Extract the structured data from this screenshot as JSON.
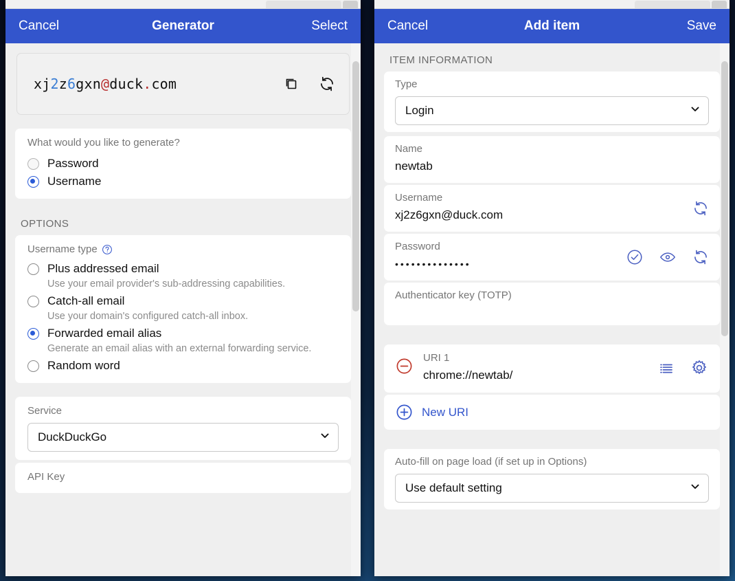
{
  "generator": {
    "titlebar": {
      "cancel": "Cancel",
      "title": "Generator",
      "select": "Select"
    },
    "generated": {
      "parts": [
        {
          "t": "xj",
          "c": "plain"
        },
        {
          "t": "2",
          "c": "num"
        },
        {
          "t": "z",
          "c": "plain"
        },
        {
          "t": "6",
          "c": "num"
        },
        {
          "t": "gxn",
          "c": "plain"
        },
        {
          "t": "@",
          "c": "spec"
        },
        {
          "t": "duck",
          "c": "plain"
        },
        {
          "t": ".",
          "c": "spec"
        },
        {
          "t": "com",
          "c": "plain"
        }
      ],
      "full_text": "xj2z6gxn@duck.com",
      "copy_icon": "copy-icon",
      "regenerate_icon": "refresh-icon"
    },
    "generate_question": "What would you like to generate?",
    "generate_options": [
      {
        "label": "Password",
        "selected": false
      },
      {
        "label": "Username",
        "selected": true
      }
    ],
    "options_heading": "OPTIONS",
    "username_type_label": "Username type",
    "username_type_help_icon": "help-circle-icon",
    "username_types": [
      {
        "label": "Plus addressed email",
        "desc": "Use your email provider's sub-addressing capabilities.",
        "selected": false
      },
      {
        "label": "Catch-all email",
        "desc": "Use your domain's configured catch-all inbox.",
        "selected": false
      },
      {
        "label": "Forwarded email alias",
        "desc": "Generate an email alias with an external forwarding service.",
        "selected": true
      },
      {
        "label": "Random word",
        "desc": "",
        "selected": false
      }
    ],
    "service_label": "Service",
    "service_value": "DuckDuckGo",
    "api_key_label": "API Key"
  },
  "additem": {
    "titlebar": {
      "cancel": "Cancel",
      "title": "Add item",
      "save": "Save"
    },
    "section_heading": "ITEM INFORMATION",
    "type_label": "Type",
    "type_value": "Login",
    "name_label": "Name",
    "name_value": "newtab",
    "username_label": "Username",
    "username_value": "xj2z6gxn@duck.com",
    "username_generate_icon": "refresh-icon",
    "password_label": "Password",
    "password_value": "••••••••••••••",
    "password_icons": [
      "check-circle-icon",
      "eye-icon",
      "refresh-icon"
    ],
    "totp_label": "Authenticator key (TOTP)",
    "totp_value": "",
    "uri": {
      "remove_icon": "minus-circle-icon",
      "label": "URI 1",
      "value": "chrome://newtab/",
      "icons": [
        "list-icon",
        "gear-icon"
      ]
    },
    "new_uri": {
      "icon": "plus-circle-icon",
      "label": "New URI"
    },
    "autofill_label": "Auto-fill on page load (if set up in Options)",
    "autofill_value": "Use default setting"
  },
  "colors": {
    "header_blue": "#3355cc",
    "accent_blue": "#2a5bd7",
    "link_blue": "#3355cc",
    "danger_red": "#c0392b",
    "digit_blue": "#3a7dd4",
    "special_red": "#b83030"
  }
}
